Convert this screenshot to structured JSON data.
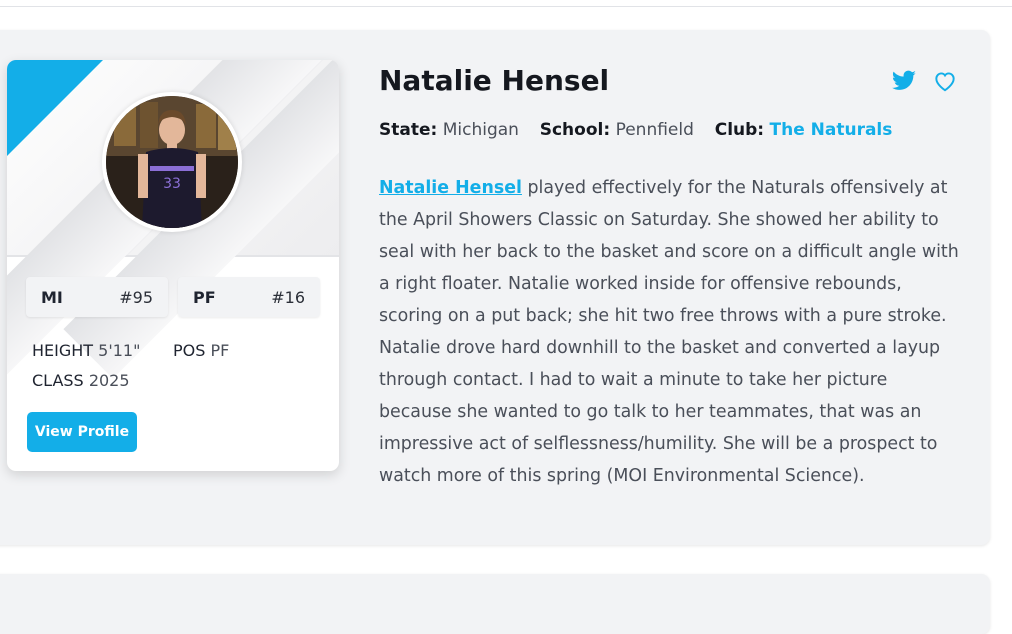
{
  "player": {
    "name": "Natalie Hensel",
    "state_label": "State:",
    "state": "Michigan",
    "school_label": "School:",
    "school": "Pennfield",
    "club_label": "Club:",
    "club": "The Naturals",
    "state_abbr": "MI",
    "state_rank": "#95",
    "position_abbr": "PF",
    "position_rank": "#16",
    "height_label": "HEIGHT",
    "height": "5'11\"",
    "pos_label": "POS",
    "pos": "PF",
    "class_label": "CLASS",
    "class_year": "2025",
    "view_profile_label": "View Profile"
  },
  "bio": {
    "link_text": "Natalie Hensel",
    "text": " played effectively for the Naturals offensively at the April Showers Classic on Saturday. She showed her ability to seal with her back to the basket and score on a difficult angle with a right floater. Natalie worked inside for offensive rebounds, scoring on a put back; she hit two free throws with a pure stroke. Natalie drove hard downhill to the basket and converted a layup through contact. I had to wait a minute to take her picture because she wanted to go talk to her teammates, that was an impressive act of selflessness/humility. She will be a prospect to watch more of this spring (MOI Environmental Science)."
  },
  "icons": {
    "twitter": "twitter-icon",
    "favorite": "heart-icon"
  },
  "colors": {
    "accent": "#13aee8",
    "card_bg": "#f2f3f5"
  }
}
